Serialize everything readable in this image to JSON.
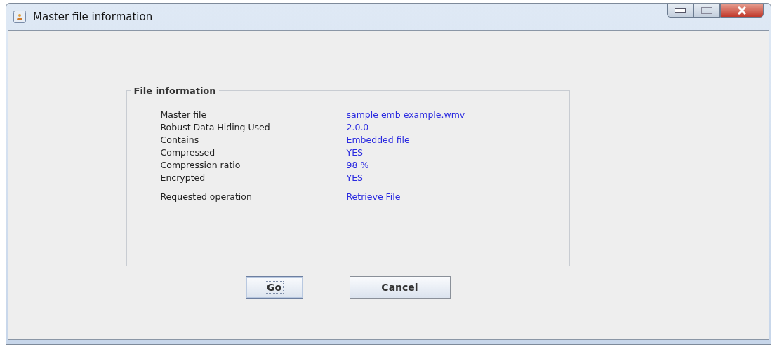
{
  "window": {
    "title": "Master file information"
  },
  "group": {
    "title": "File information",
    "fields": [
      {
        "label": "Master file",
        "value": "sample emb example.wmv"
      },
      {
        "label": "Robust Data Hiding Used",
        "value": "2.0.0"
      },
      {
        "label": "Contains",
        "value": "Embedded file"
      },
      {
        "label": "Compressed",
        "value": "YES"
      },
      {
        "label": "Compression ratio",
        "value": "98 %"
      },
      {
        "label": "Encrypted",
        "value": "YES"
      }
    ],
    "operation": {
      "label": "Requested operation",
      "value": "Retrieve File"
    }
  },
  "buttons": [
    {
      "label": "Go",
      "focused": true
    },
    {
      "label": "Cancel",
      "focused": false
    }
  ]
}
